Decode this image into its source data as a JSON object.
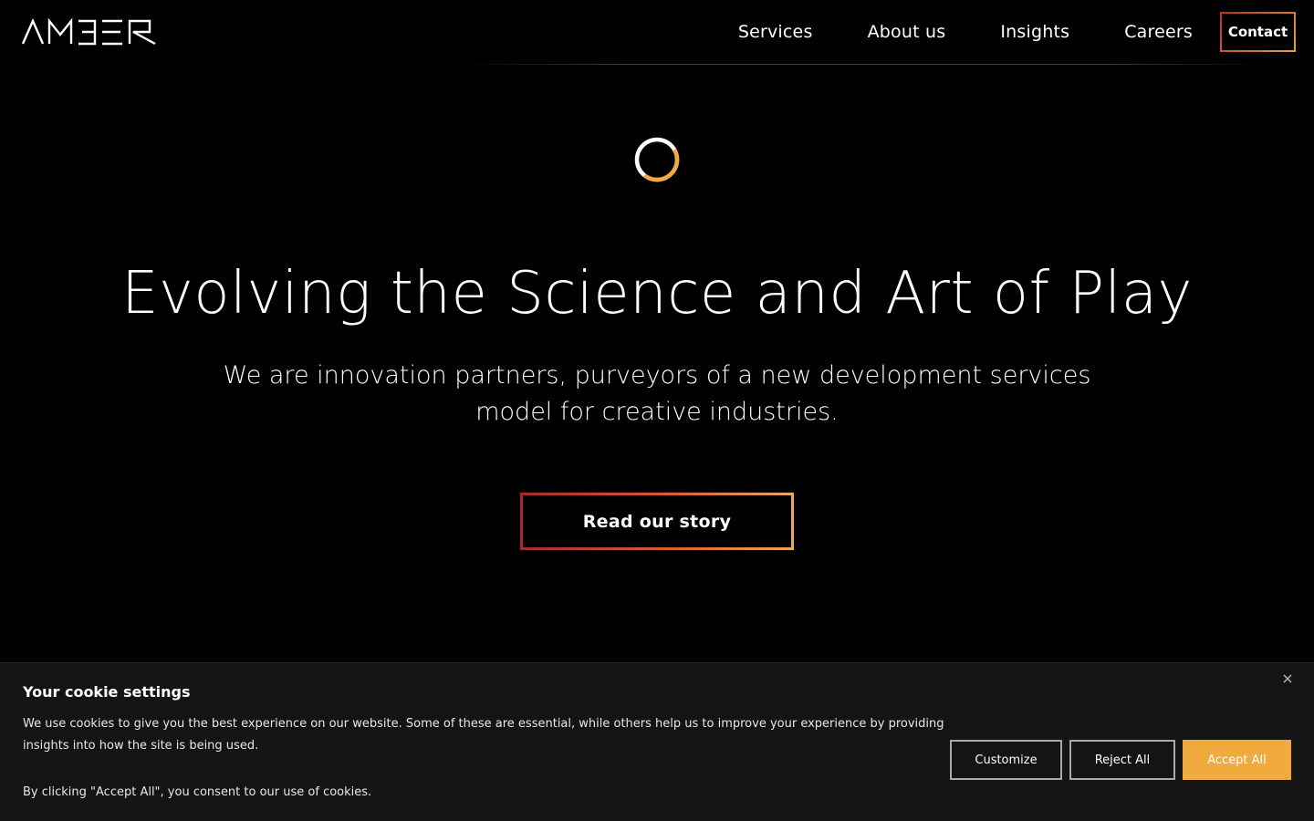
{
  "brand": {
    "logo_text": "AMBER"
  },
  "nav": {
    "items": [
      {
        "label": "Services"
      },
      {
        "label": "About us"
      },
      {
        "label": "Insights"
      },
      {
        "label": "Careers"
      }
    ],
    "contact_label": "Contact"
  },
  "hero": {
    "title": "Evolving the Science and Art of Play",
    "subtitle": "We are innovation partners, purveyors of a new development services model for creative industries.",
    "cta_label": "Read our story"
  },
  "cookie": {
    "title": "Your cookie settings",
    "text": "We use cookies to give you the best experience on our website. Some of these are essential, while others help us to improve your experience by providing insights into how the site is being used.",
    "consent": "By clicking \"Accept All\", you consent to our use of cookies.",
    "customize_label": "Customize",
    "reject_label": "Reject All",
    "accept_label": "Accept All"
  },
  "colors": {
    "accent": "#f0aa3e",
    "gradient_start": "#a82a2a",
    "gradient_end": "#e8a85a"
  },
  "icons": {
    "close": "close-icon",
    "spinner": "loading-spinner-icon"
  }
}
